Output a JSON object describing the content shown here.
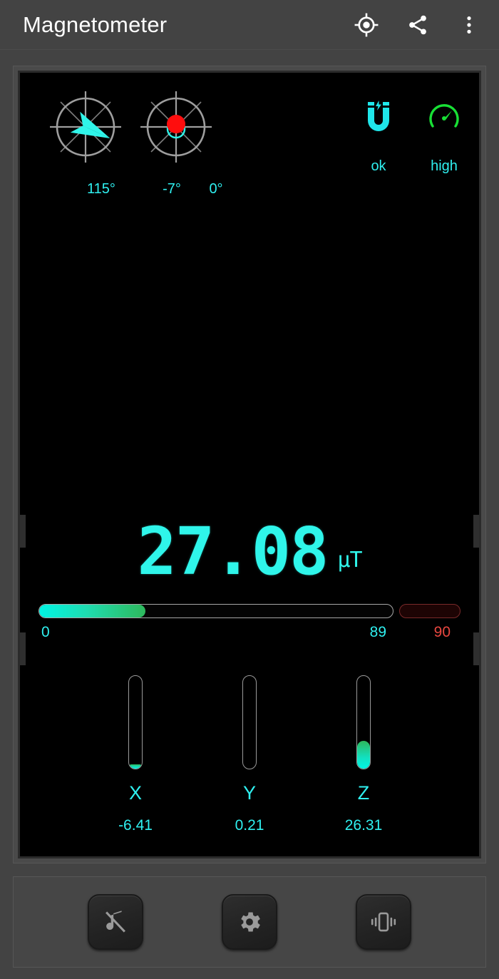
{
  "header": {
    "title": "Magnetometer",
    "actions": [
      {
        "name": "calibrate-icon",
        "label": "calibrate"
      },
      {
        "name": "share-icon",
        "label": "share"
      },
      {
        "name": "overflow-menu-icon",
        "label": "more options"
      }
    ]
  },
  "display": {
    "gauges": {
      "heading": {
        "label": "115°",
        "value": 115,
        "unit": "degrees",
        "pointer_color": "#2ff5ea"
      },
      "pitch": {
        "label": "-7°",
        "value": -7
      },
      "roll": {
        "label": "0°",
        "value": 0
      },
      "level_dot_color": "#ff0d0d",
      "level_ring_color": "#2ff5ea"
    },
    "status": [
      {
        "icon": "magnet-icon",
        "label": "ok",
        "color": "#2ff5ea"
      },
      {
        "icon": "speedometer-icon",
        "label": "high",
        "color": "#2ff5ea",
        "icon_color": "#18e035"
      }
    ],
    "readout": {
      "value": "27.08",
      "unit": "µT",
      "color": "#2ff5ea"
    },
    "range": {
      "min_label": "0",
      "max_label": "89",
      "overflow_label": "90",
      "min": 0,
      "max": 89,
      "current": 27.08,
      "fill_percent": 30,
      "fill_start_color": "#00f5e4",
      "fill_end_color": "#2eb85c",
      "overflow_color": "#e8473f"
    },
    "axes": [
      {
        "name": "X",
        "label": "X",
        "value": "-6.41",
        "fill_percent": 5
      },
      {
        "name": "Y",
        "label": "Y",
        "value": "0.21",
        "fill_percent": 0
      },
      {
        "name": "Z",
        "label": "Z",
        "value": "26.31",
        "fill_percent": 30
      }
    ]
  },
  "toolbar": {
    "buttons": [
      {
        "name": "sound-off-button",
        "icon": "music-note-off-icon",
        "label": "sound off"
      },
      {
        "name": "settings-button",
        "icon": "gear-icon",
        "label": "settings"
      },
      {
        "name": "vibrate-button",
        "icon": "vibrate-icon",
        "label": "vibrate"
      }
    ]
  },
  "chart_data": {
    "type": "bar",
    "title": "Magnetic field components",
    "categories": [
      "X",
      "Y",
      "Z"
    ],
    "values": [
      -6.41,
      0.21,
      26.31
    ],
    "ylabel": "µT",
    "total_magnitude": 27.08,
    "range": [
      0,
      89
    ],
    "overflow_threshold": 90,
    "orientation": {
      "heading_deg": 115,
      "pitch_deg": -7,
      "roll_deg": 0
    },
    "grid": false,
    "legend": false
  }
}
